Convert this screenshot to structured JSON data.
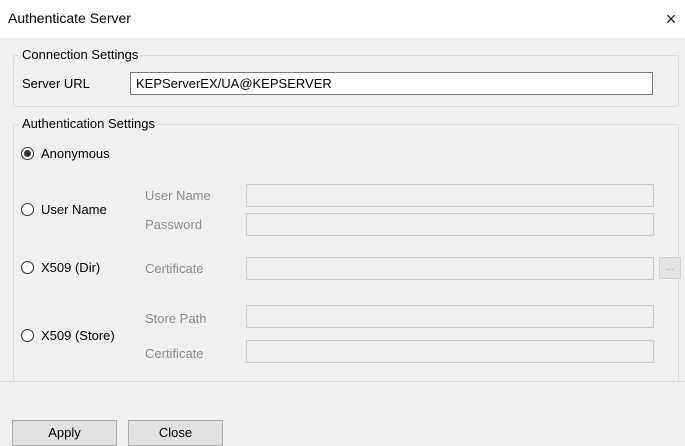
{
  "window": {
    "title": "Authenticate Server",
    "close_glyph": "×"
  },
  "connection": {
    "legend": "Connection Settings",
    "server_url_label": "Server URL",
    "server_url_value": "KEPServerEX/UA@KEPSERVER"
  },
  "auth": {
    "legend": "Authentication Settings",
    "selected": "Anonymous",
    "options": {
      "anonymous": "Anonymous",
      "username": "User Name",
      "x509_dir": "X509 (Dir)",
      "x509_store": "X509 (Store)"
    },
    "fields": {
      "user_name": "User Name",
      "password": "Password",
      "certificate_dir": "Certificate",
      "store_path": "Store Path",
      "certificate_store": "Certificate"
    },
    "browse_button_label": "..."
  },
  "buttons": {
    "apply": "Apply",
    "close": "Close"
  },
  "icons": {
    "close": "close-icon",
    "radio_selected": "radio-selected-icon",
    "radio_unselected": "radio-unselected-icon"
  },
  "colors": {
    "window_bg": "#f0f0f0",
    "disabled_text": "#8d8d8d",
    "border": "#dcdcdc"
  }
}
